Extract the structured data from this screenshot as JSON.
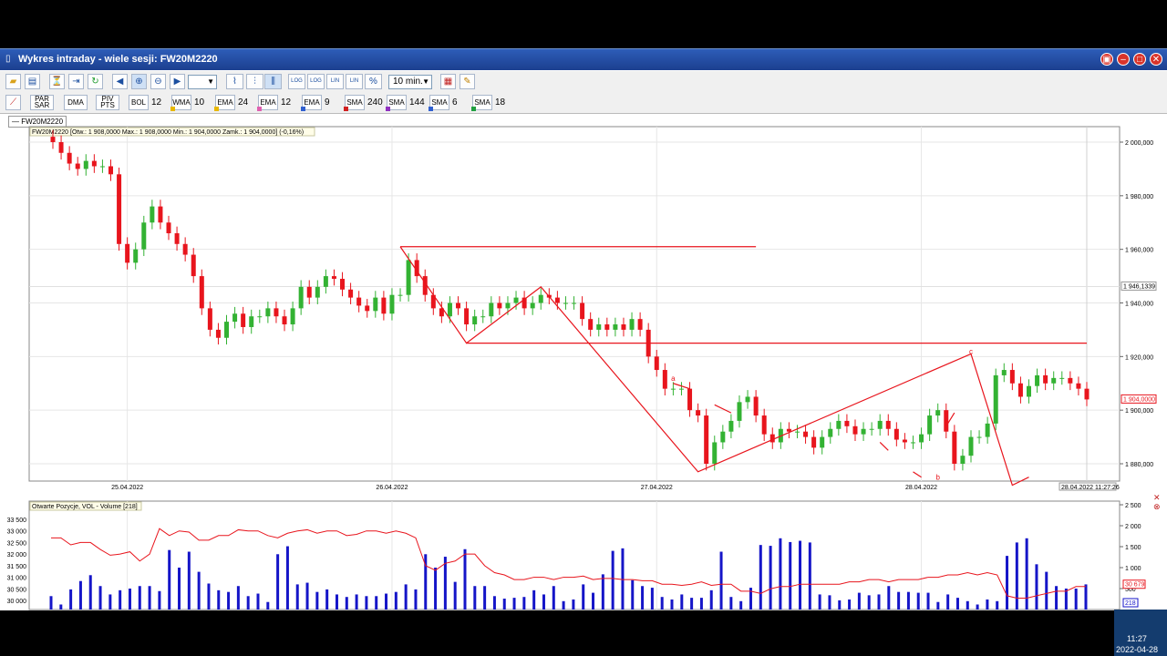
{
  "window": {
    "title": "Wykres intraday -  wiele sesji: FW20M2220",
    "controls": [
      "minimize",
      "maximize",
      "close"
    ]
  },
  "toolbar": {
    "interval": "10 min.",
    "style_combo": "",
    "indicators": [
      {
        "name": "PAR\nSAR",
        "value": ""
      },
      {
        "name": "DMA",
        "value": ""
      },
      {
        "name": "PIV\nPTS",
        "value": ""
      },
      {
        "name": "BOL",
        "value": "12"
      },
      {
        "name": "WMA",
        "value": "10"
      },
      {
        "name": "EMA",
        "value": "24"
      },
      {
        "name": "EMA",
        "value": "12"
      },
      {
        "name": "EMA",
        "value": "9"
      },
      {
        "name": "SMA",
        "value": "240"
      },
      {
        "name": "SMA",
        "value": "144"
      },
      {
        "name": "SMA",
        "value": "6"
      },
      {
        "name": "SMA",
        "value": "18"
      }
    ]
  },
  "legend_label": "FW20M2220",
  "colors": {
    "up": "#33b233",
    "down": "#e8151d",
    "volume": "#1515c8",
    "oi_line": "#e8151d",
    "trend": "#e8151d",
    "accent": "#2d5db8"
  },
  "chart_data": [
    {
      "type": "candlestick",
      "header": "FW20M2220 [Otw.: 1 908,0000  Max.: 1 908,0000  Min.: 1 904,0000  Zamk.: 1 904,0000] (-0,16%)",
      "ylim": [
        1870000,
        2005000
      ],
      "yticks": [
        1880000,
        1900000,
        1920000,
        1940000,
        1960000,
        1980000,
        2000000
      ],
      "ytick_labels": [
        "1 880,000",
        "1 900,000",
        "1 920,000",
        "1 940,000",
        "1 960,000",
        "1 980,000",
        "2 000,000"
      ],
      "x_labels": [
        "25.04.2022",
        "26.04.2022",
        "27.04.2022",
        "28.04.2022"
      ],
      "x_label_index": [
        9,
        41,
        73,
        105
      ],
      "cursor_price_label": "1 946,1339",
      "last_price_label": "1 904,0000",
      "cursor_time_label": "28.04.2022 11:27:26",
      "grid": true,
      "closes": [
        2000,
        1996,
        1992,
        1990,
        1993,
        1991,
        1991,
        1988,
        1962,
        1955,
        1960,
        1970,
        1976,
        1970,
        1966,
        1962,
        1958,
        1950,
        1938,
        1930,
        1927,
        1933,
        1936,
        1931,
        1935,
        1935,
        1938,
        1935,
        1932,
        1938,
        1946,
        1942,
        1946,
        1950,
        1949,
        1945,
        1942,
        1939,
        1937,
        1942,
        1936,
        1943,
        1943,
        1956,
        1950,
        1943,
        1938,
        1935,
        1940,
        1938,
        1932,
        1935,
        1935,
        1940,
        1938,
        1940,
        1942,
        1938,
        1940,
        1943,
        1942,
        1940,
        1940,
        1940,
        1934,
        1930,
        1932,
        1930,
        1932,
        1930,
        1934,
        1930,
        1920,
        1915,
        1908,
        1908,
        1908,
        1900,
        1898,
        1880,
        1888,
        1892,
        1896,
        1903,
        1905,
        1898,
        1891,
        1888,
        1893,
        1892,
        1892,
        1890,
        1886,
        1890,
        1893,
        1896,
        1894,
        1891,
        1893,
        1893,
        1896,
        1893,
        1889,
        1888,
        1888,
        1891,
        1898,
        1900,
        1892,
        1880,
        1883,
        1890,
        1890,
        1895,
        1913,
        1915,
        1910,
        1905,
        1909,
        1913,
        1910,
        1912,
        1912,
        1910,
        1908,
        1904
      ],
      "volumes": [
        320,
        120,
        480,
        680,
        820,
        560,
        360,
        460,
        500,
        560,
        560,
        440,
        1420,
        1000,
        1380,
        900,
        620,
        460,
        420,
        560,
        320,
        380,
        180,
        1320,
        1510,
        600,
        640,
        420,
        480,
        360,
        300,
        360,
        320,
        320,
        380,
        420,
        600,
        480,
        1320,
        1000,
        1260,
        660,
        1440,
        560,
        560,
        320,
        260,
        280,
        300,
        460,
        360,
        560,
        200,
        240,
        600,
        400,
        840,
        1400,
        1460,
        700,
        560,
        520,
        300,
        240,
        360,
        280,
        280,
        460,
        1380,
        300,
        200,
        520,
        1540,
        1520,
        1700,
        1610,
        1640,
        1600,
        360,
        340,
        220,
        240,
        400,
        340,
        360,
        560,
        420,
        420,
        400,
        400,
        180,
        360,
        280,
        200,
        120,
        240,
        200,
        1280,
        1600,
        1700,
        1080,
        900,
        560,
        500,
        500,
        600
      ],
      "oi": [
        32700,
        32700,
        32400,
        32500,
        32500,
        32200,
        31950,
        32000,
        32100,
        31700,
        32000,
        33100,
        32800,
        33000,
        32950,
        32600,
        32600,
        32800,
        32800,
        33050,
        33000,
        33000,
        32800,
        32700,
        32900,
        33000,
        33050,
        32900,
        33000,
        33000,
        32800,
        32850,
        33000,
        33000,
        32900,
        33000,
        32900,
        32700,
        31500,
        31300,
        31600,
        31700,
        32000,
        32000,
        31500,
        31200,
        31100,
        30900,
        30900,
        31000,
        31000,
        30900,
        31000,
        31000,
        31050,
        30900,
        30950,
        30950,
        30900,
        30900,
        30850,
        30850,
        30700,
        30700,
        30650,
        30700,
        30800,
        30650,
        30700,
        30700,
        30400,
        30400,
        30300,
        30500,
        30600,
        30600,
        30700,
        30700,
        30700,
        30700,
        30700,
        30800,
        30800,
        30900,
        30900,
        30800,
        30900,
        30900,
        30900,
        31000,
        31000,
        31100,
        31100,
        31200,
        31100,
        31200,
        31100,
        30200,
        30100,
        30100,
        30200,
        30300,
        30400,
        30400,
        30600,
        30600
      ],
      "volume_panel": {
        "header": "Otwarte Pozycje, VOL - Volume [218]",
        "left_ticks": [
          "33 500",
          "33 000",
          "32 500",
          "32 000",
          "31 500",
          "31 000",
          "30 500",
          "30 000"
        ],
        "right_ticks": [
          "2 500",
          "2 000",
          "1 500",
          "1 000",
          "500"
        ],
        "oi_label": "30 679",
        "vol_label": "218"
      },
      "annotations": [
        {
          "label": "a",
          "index": 75,
          "price": 1911
        },
        {
          "label": "b",
          "index": 107,
          "price": 1874
        },
        {
          "label": "c",
          "index": 111,
          "price": 1921
        }
      ]
    }
  ],
  "clock": {
    "time": "11:27",
    "date": "2022-04-28"
  }
}
